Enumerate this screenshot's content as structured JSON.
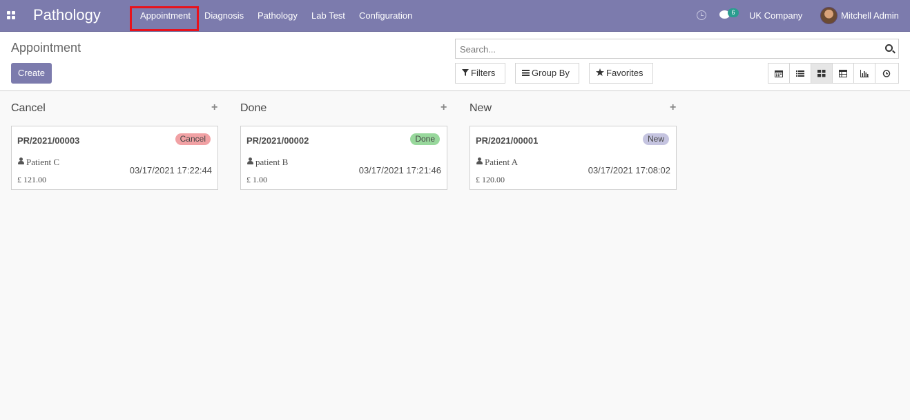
{
  "navbar": {
    "app_title": "Pathology",
    "menu": [
      "Appointment",
      "Diagnosis",
      "Pathology",
      "Lab Test",
      "Configuration"
    ],
    "chat_count": "6",
    "company": "UK Company",
    "user": "Mitchell Admin",
    "bg_color": "#7c7bad"
  },
  "control": {
    "title": "Appointment",
    "create_label": "Create",
    "search_placeholder": "Search...",
    "filters_label": "Filters",
    "groupby_label": "Group By",
    "favorites_label": "Favorites",
    "views": [
      "calendar-icon",
      "list-icon",
      "kanban-icon",
      "pivot-icon",
      "graph-icon",
      "activity-icon"
    ],
    "active_view": "kanban-icon"
  },
  "kanban": {
    "columns": [
      {
        "title": "Cancel",
        "card": {
          "ref": "PR/2021/00003",
          "state": "Cancel",
          "state_color": "#f1a1a4",
          "patient": "Patient C",
          "amount": "£ 121.00",
          "date": "03/17/2021 17:22:44"
        }
      },
      {
        "title": "Done",
        "card": {
          "ref": "PR/2021/00002",
          "state": "Done",
          "state_color": "#98d89c",
          "patient": "patient B",
          "amount": "£ 1.00",
          "date": "03/17/2021 17:21:46"
        }
      },
      {
        "title": "New",
        "card": {
          "ref": "PR/2021/00001",
          "state": "New",
          "state_color": "#c5c4e0",
          "patient": "Patient A",
          "amount": "£ 120.00",
          "date": "03/17/2021 17:08:02"
        }
      }
    ]
  }
}
